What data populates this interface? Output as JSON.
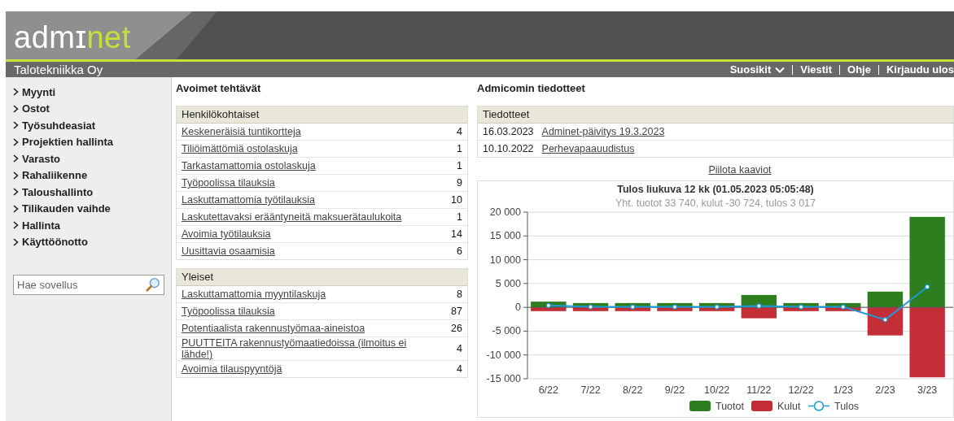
{
  "header": {
    "logo_start": "admɪ",
    "logo_end": "net",
    "company": "Talotekniikka Oy",
    "nav": [
      {
        "label": "Suosikit",
        "dropdown": true
      },
      {
        "label": "Viestit",
        "dropdown": false
      },
      {
        "label": "Ohje",
        "dropdown": false
      },
      {
        "label": "Kirjaudu ulos",
        "dropdown": false
      }
    ]
  },
  "sidebar": {
    "items": [
      "Myynti",
      "Ostot",
      "Työsuhdeasiat",
      "Projektien hallinta",
      "Varasto",
      "Rahaliikenne",
      "Taloushallinto",
      "Tilikauden vaihde",
      "Hallinta",
      "Käyttöönotto"
    ],
    "search": {
      "placeholder": "Hae sovellus"
    }
  },
  "tasks": {
    "title": "Avoimet tehtävät",
    "groups": [
      {
        "title": "Henkilökohtaiset",
        "rows": [
          {
            "label": "Keskeneräisiä tuntikortteja",
            "count": "4"
          },
          {
            "label": "Tiliöimättömiä ostolaskuja",
            "count": "1"
          },
          {
            "label": "Tarkastamattomia ostolaskuja",
            "count": "1"
          },
          {
            "label": "Työpoolissa tilauksia",
            "count": "9"
          },
          {
            "label": "Laskuttamattomia työtilauksia",
            "count": "10"
          },
          {
            "label": "Laskutettavaksi erääntyneitä maksuerätaulukoita",
            "count": "1"
          },
          {
            "label": "Avoimia työtilauksia",
            "count": "14"
          },
          {
            "label": "Uusittavia osaamisia",
            "count": "6"
          }
        ]
      },
      {
        "title": "Yleiset",
        "rows": [
          {
            "label": "Laskuttamattomia myyntilaskuja",
            "count": "8"
          },
          {
            "label": "Työpoolissa tilauksia",
            "count": "87"
          },
          {
            "label": "Potentiaalista rakennustyömaa-aineistoa",
            "count": "26"
          },
          {
            "label": "PUUTTEITA rakennustyömaatiedoissa (ilmoitus ei lähde!)",
            "count": "4"
          },
          {
            "label": "Avoimia tilauspyyntöjä",
            "count": "4"
          }
        ]
      }
    ]
  },
  "news": {
    "title": "Admicomin tiedotteet",
    "table_title": "Tiedotteet",
    "rows": [
      {
        "date": "16.03.2023",
        "link": "Adminet-päivitys 19.3.2023"
      },
      {
        "date": "10.10.2022",
        "link": "Perhevapaauudistus"
      }
    ],
    "hide_link": "Piilota kaaviot",
    "chart_data": {
      "type": "bar",
      "title": "Tulos liukuva 12 kk (01.05.2023 05:05:48)",
      "subtitle": "Yht. tuotot 33 740, kulut -30 724, tulos 3 017",
      "categories": [
        "6/22",
        "7/22",
        "8/22",
        "9/22",
        "10/22",
        "11/22",
        "12/22",
        "1/23",
        "2/23",
        "3/23"
      ],
      "ylim": [
        -15000,
        20000
      ],
      "yticks": [
        {
          "value": 20000,
          "label": "20 000"
        },
        {
          "value": 15000,
          "label": "15 000"
        },
        {
          "value": 10000,
          "label": "10 000"
        },
        {
          "value": 5000,
          "label": "5 000"
        },
        {
          "value": 0,
          "label": "0"
        },
        {
          "value": -5000,
          "label": "-5 000"
        },
        {
          "value": -10000,
          "label": "-10 000"
        },
        {
          "value": -15000,
          "label": "-15 000"
        }
      ],
      "stacked": true,
      "grid": true,
      "legend": true,
      "series": [
        {
          "name": "Tuotot",
          "type": "bar",
          "color": "#2e7d1f",
          "values": [
            1200,
            900,
            900,
            900,
            900,
            2600,
            900,
            900,
            3300,
            19000
          ]
        },
        {
          "name": "Kulut",
          "type": "bar",
          "color": "#c42e37",
          "values": [
            -800,
            -800,
            -800,
            -800,
            -800,
            -2300,
            -800,
            -800,
            -5900,
            -14700
          ]
        },
        {
          "name": "Tulos",
          "type": "line",
          "marker": "circle",
          "color": "#1e9bd7",
          "values": [
            400,
            100,
            100,
            100,
            100,
            300,
            100,
            100,
            -2600,
            4300
          ]
        }
      ]
    }
  }
}
